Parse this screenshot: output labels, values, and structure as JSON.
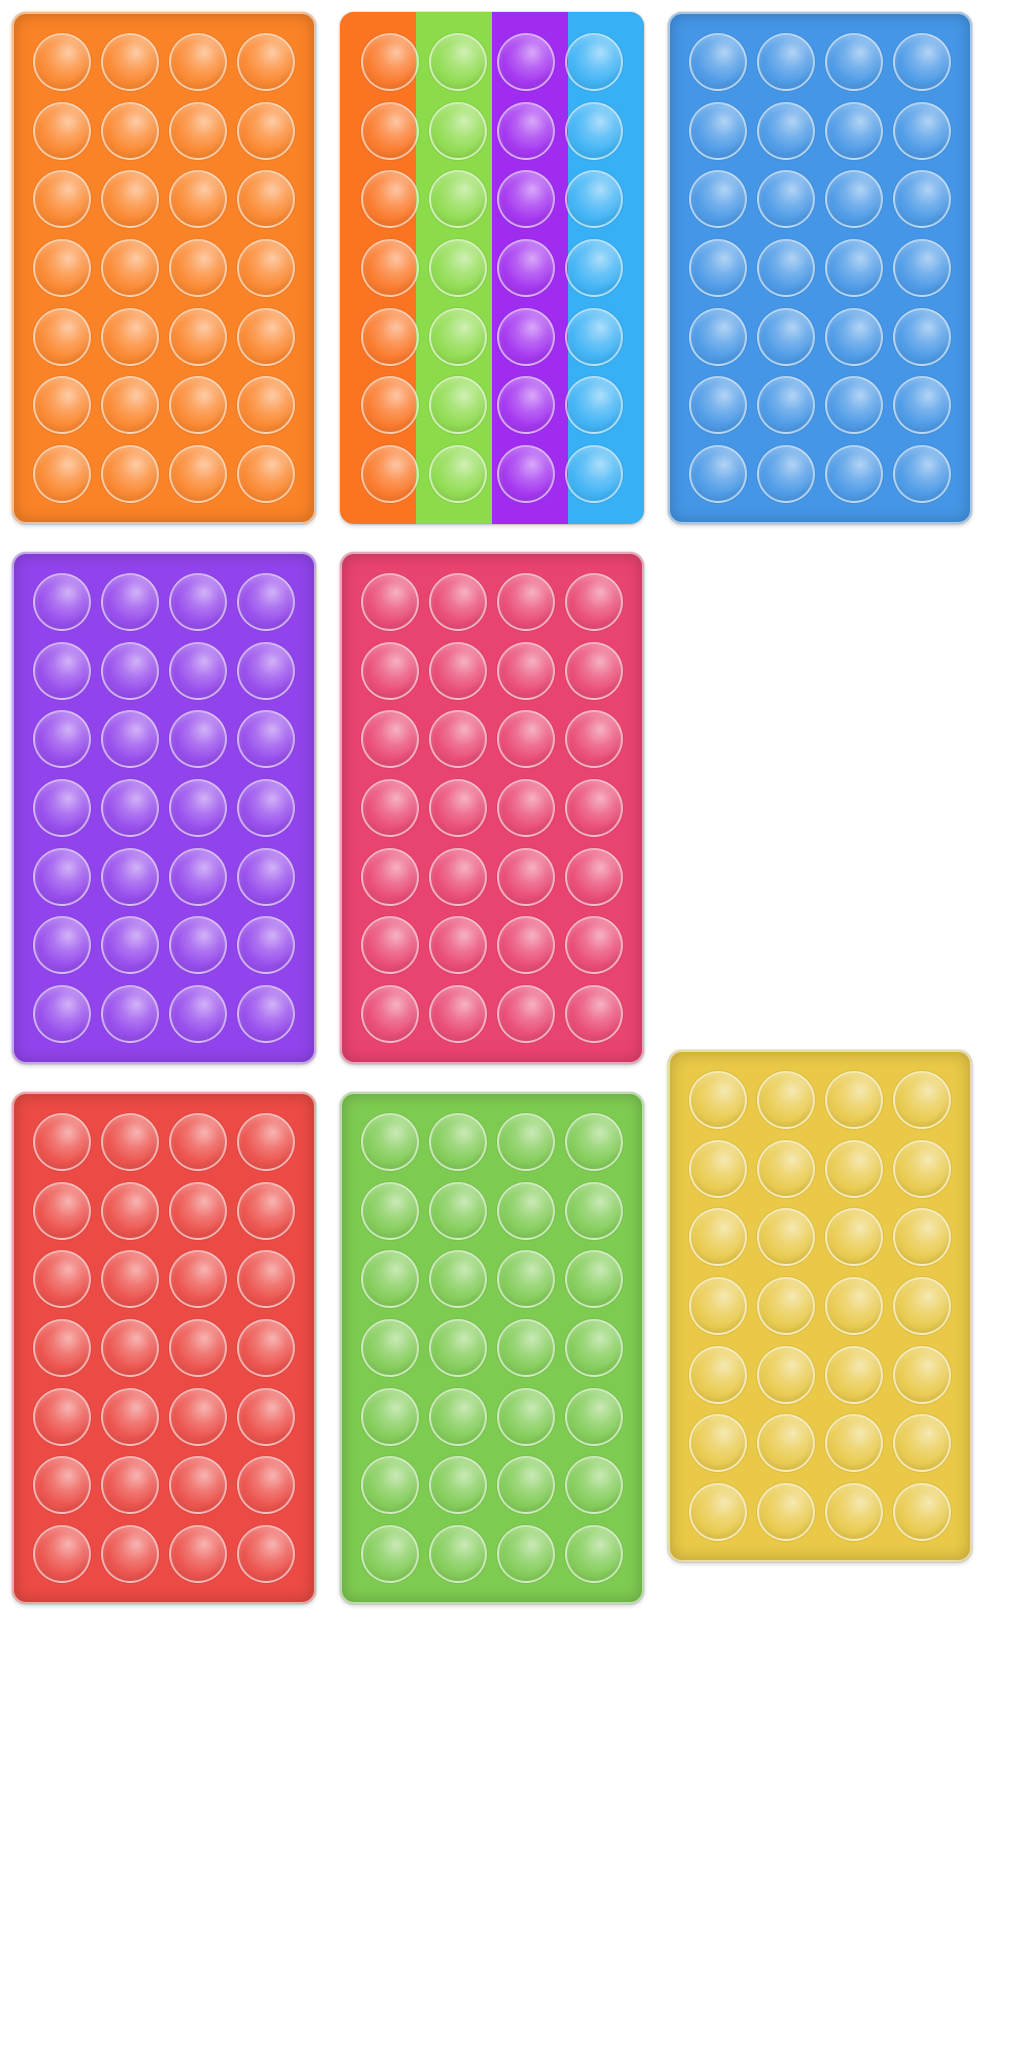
{
  "boards": [
    {
      "id": "orange",
      "colors": [
        "#fb8327"
      ]
    },
    {
      "id": "rainbow",
      "colors": [
        "#fb7422",
        "#8cdb4a",
        "#a02cf0",
        "#37b0f5"
      ]
    },
    {
      "id": "blue",
      "colors": [
        "#4596e6"
      ]
    },
    {
      "id": "purple",
      "colors": [
        "#9244ec"
      ]
    },
    {
      "id": "pink",
      "colors": [
        "#e9436f"
      ]
    },
    {
      "id": "red",
      "colors": [
        "#ec4a44"
      ]
    },
    {
      "id": "green",
      "colors": [
        "#7ecb52"
      ]
    },
    {
      "id": "yellow",
      "colors": [
        "#e9c947"
      ]
    }
  ],
  "grid": {
    "columns": 4,
    "rows": 7
  }
}
